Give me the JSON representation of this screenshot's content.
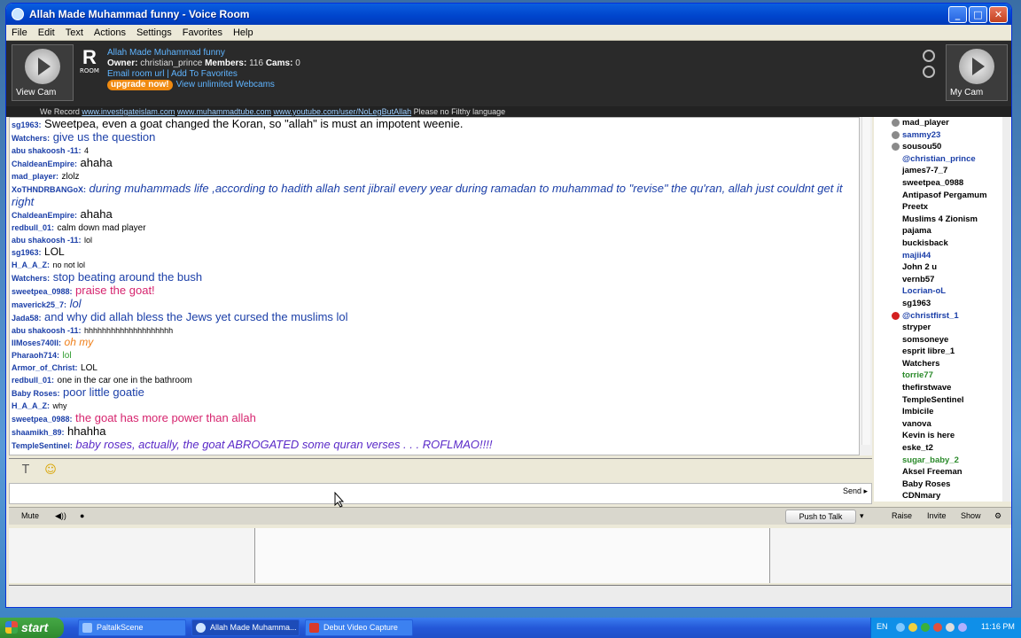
{
  "window": {
    "title": "Allah Made Muhammad funny - Voice Room"
  },
  "menu": [
    "File",
    "Edit",
    "Text",
    "Actions",
    "Settings",
    "Favorites",
    "Help"
  ],
  "room": {
    "badge_letter": "R",
    "badge_sub": "ROOM",
    "title": "Allah Made Muhammad funny",
    "owner_label": "Owner:",
    "owner": "christian_prince",
    "members_label": "Members:",
    "members": "116",
    "cams_label": "Cams:",
    "cams": "0",
    "links": "Email room url | Add To Favorites",
    "upgrade": "upgrade now!",
    "unlimited": "View unlimited Webcams",
    "view_cam": "View Cam",
    "my_cam": "My Cam"
  },
  "recordbar": {
    "prefix": "We Record",
    "link1": "www.investigateislam.com",
    "link2": "www.muhammadtube.com",
    "link3": "www.youtube.com/user/NoLegButAllah",
    "suffix": "Please no Filthy language"
  },
  "messages": [
    {
      "who": "sg1963:",
      "text": "Sweetpea, even a goat changed the Koran, so \"allah\" is must an impotent weenie.",
      "color": "#000000",
      "size": 13,
      "italic": false
    },
    {
      "who": "Watchers:",
      "text": "give us the question",
      "color": "#1b3fa8",
      "size": 13,
      "italic": false
    },
    {
      "who": "abu shakoosh -11:",
      "text": "4",
      "color": "#000000",
      "size": 9,
      "italic": false
    },
    {
      "who": "ChaldeanEmpire:",
      "text": "ahaha",
      "color": "#000000",
      "size": 13,
      "italic": false
    },
    {
      "who": "mad_player:",
      "text": "zlolz",
      "color": "#000000",
      "size": 10,
      "italic": false
    },
    {
      "who": "XoTHNDRBANGoX:",
      "text": "during muhammads life ,according to hadith  allah sent jibrail every year during ramadan to muhammad to \"revise\" the qu'ran, allah just couldnt get it right",
      "color": "#1b3fa8",
      "size": 13,
      "italic": true
    },
    {
      "who": "ChaldeanEmpire:",
      "text": "ahaha",
      "color": "#000000",
      "size": 13,
      "italic": false
    },
    {
      "who": "redbull_01:",
      "text": "calm down mad player",
      "color": "#000000",
      "size": 10,
      "italic": false
    },
    {
      "who": "abu shakoosh -11:",
      "text": "lol",
      "color": "#000000",
      "size": 9,
      "italic": false
    },
    {
      "who": "sg1963:",
      "text": "LOL",
      "color": "#000000",
      "size": 12,
      "italic": false
    },
    {
      "who": "H_A_A_Z:",
      "text": "no not lol",
      "color": "#000000",
      "size": 9,
      "italic": false
    },
    {
      "who": "Watchers:",
      "text": "stop beating around the bush",
      "color": "#1b3fa8",
      "size": 13,
      "italic": false
    },
    {
      "who": "sweetpea_0988:",
      "text": "praise the goat!",
      "color": "#d6246e",
      "size": 13,
      "italic": false
    },
    {
      "who": "maverick25_7:",
      "text": "lol",
      "color": "#1b3fa8",
      "size": 13,
      "italic": true
    },
    {
      "who": "Jada58:",
      "text": "and why did allah bless the Jews yet cursed the muslims lol",
      "color": "#1b3fa8",
      "size": 13,
      "italic": false
    },
    {
      "who": "abu shakoosh -11:",
      "text": "hhhhhhhhhhhhhhhhhhhh",
      "color": "#000000",
      "size": 9,
      "italic": false
    },
    {
      "who": "IIMoses740II:",
      "text": "oh my",
      "color": "#ef7f1a",
      "size": 12,
      "italic": true
    },
    {
      "who": "Pharaoh714:",
      "text": "lol",
      "color": "#2a9a2a",
      "size": 10,
      "italic": false
    },
    {
      "who": "Armor_of_Christ:",
      "text": "LOL",
      "color": "#000000",
      "size": 10,
      "italic": false
    },
    {
      "who": "redbull_01:",
      "text": "one in the car one in the bathroom",
      "color": "#000000",
      "size": 10,
      "italic": false
    },
    {
      "who": "Baby Roses:",
      "text": "poor little goatie",
      "color": "#1b3fa8",
      "size": 13,
      "italic": false
    },
    {
      "who": "H_A_A_Z:",
      "text": "why",
      "color": "#000000",
      "size": 9,
      "italic": false
    },
    {
      "who": "sweetpea_0988:",
      "text": "the goat has more power than allah",
      "color": "#d6246e",
      "size": 13,
      "italic": false
    },
    {
      "who": "shaamikh_89:",
      "text": "hhahha",
      "color": "#000000",
      "size": 13,
      "italic": false
    },
    {
      "who": "TempleSentinel:",
      "text": "baby roses, actually, the goat ABROGATED some quran verses . . . ROFLMAO!!!!",
      "color": "#5a2ac8",
      "size": 13,
      "italic": true
    }
  ],
  "users": [
    {
      "name": "mad_player",
      "color": "#000000",
      "icon": "#8a8a8a"
    },
    {
      "name": "sammy23",
      "color": "#1b3fa8",
      "icon": "#8a8a8a"
    },
    {
      "name": "sousou50",
      "color": "#000000",
      "icon": "#8a8a8a"
    },
    {
      "name": "@christian_prince",
      "color": "#1b3fa8",
      "icon": ""
    },
    {
      "name": "james7-7_7",
      "color": "#000000",
      "icon": ""
    },
    {
      "name": "sweetpea_0988",
      "color": "#000000",
      "icon": ""
    },
    {
      "name": "Antipasof Pergamum",
      "color": "#000000",
      "icon": ""
    },
    {
      "name": "Preetx",
      "color": "#000000",
      "icon": ""
    },
    {
      "name": "Muslims 4 Zionism",
      "color": "#000000",
      "icon": ""
    },
    {
      "name": "pajama",
      "color": "#000000",
      "icon": ""
    },
    {
      "name": "buckisback",
      "color": "#000000",
      "icon": ""
    },
    {
      "name": "majii44",
      "color": "#1b3fa8",
      "icon": ""
    },
    {
      "name": "John 2 u",
      "color": "#000000",
      "icon": ""
    },
    {
      "name": "vernb57",
      "color": "#000000",
      "icon": ""
    },
    {
      "name": "Locrian-oL",
      "color": "#1b3fa8",
      "icon": ""
    },
    {
      "name": "sg1963",
      "color": "#000000",
      "icon": ""
    },
    {
      "name": "@christfirst_1",
      "color": "#1b3fa8",
      "icon": "#d42020"
    },
    {
      "name": "stryper",
      "color": "#000000",
      "icon": ""
    },
    {
      "name": "somsoneye",
      "color": "#000000",
      "icon": ""
    },
    {
      "name": "esprit libre_1",
      "color": "#000000",
      "icon": ""
    },
    {
      "name": "Watchers",
      "color": "#000000",
      "icon": ""
    },
    {
      "name": "torrie77",
      "color": "#2a8a2a",
      "icon": ""
    },
    {
      "name": "thefirstwave",
      "color": "#000000",
      "icon": ""
    },
    {
      "name": "TempleSentinel",
      "color": "#000000",
      "icon": ""
    },
    {
      "name": "Imbicile",
      "color": "#000000",
      "icon": ""
    },
    {
      "name": "vanova",
      "color": "#000000",
      "icon": ""
    },
    {
      "name": "Kevin is here",
      "color": "#000000",
      "icon": ""
    },
    {
      "name": "eske_t2",
      "color": "#000000",
      "icon": ""
    },
    {
      "name": "sugar_baby_2",
      "color": "#2a8a2a",
      "icon": ""
    },
    {
      "name": "Aksel Freeman",
      "color": "#000000",
      "icon": ""
    },
    {
      "name": "Baby Roses",
      "color": "#000000",
      "icon": ""
    },
    {
      "name": "CDNmary",
      "color": "#000000",
      "icon": ""
    }
  ],
  "input": {
    "send": "Send ▸"
  },
  "controls": {
    "mute": "Mute",
    "push_to_talk": "Push to Talk",
    "raise": "Raise",
    "invite": "Invite",
    "show": "Show"
  },
  "taskbar": {
    "start": "start",
    "tasks": [
      {
        "label": "PaltalkScene",
        "active": false
      },
      {
        "label": "Allah Made Muhamma...",
        "active": true
      },
      {
        "label": "Debut Video Capture",
        "active": false
      }
    ],
    "lang": "EN",
    "clock": "11:16 PM"
  }
}
